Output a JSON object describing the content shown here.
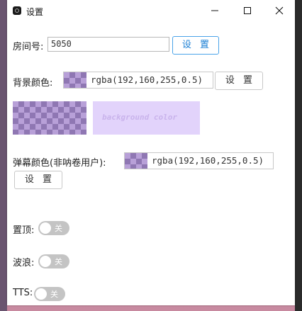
{
  "window": {
    "title": "设置",
    "controls": {
      "minimize": "minimize-icon",
      "maximize": "maximize-icon",
      "close": "close-icon"
    }
  },
  "room": {
    "label": "房间号:",
    "value": "5050",
    "button_label": "设 置"
  },
  "background": {
    "label": "背景颜色:",
    "color_value": "rgba(192,160,255,0.5)",
    "button_label": "设 置",
    "preview_text": "background color"
  },
  "danmaku": {
    "label": "弹幕颜色(非呐卷用户):",
    "color_value": "rgba(192,160,255,0.5)",
    "button_label": "设 置"
  },
  "toggles": [
    {
      "label": "置顶:",
      "state_label": "关",
      "on": false
    },
    {
      "label": "波浪:",
      "state_label": "关",
      "on": false
    },
    {
      "label": "TTS:",
      "state_label": "关",
      "on": false
    }
  ],
  "colors": {
    "accent": "#1a7fd4",
    "swatch": "#c0a0ff",
    "toggle_off": "#c4c4c4"
  }
}
